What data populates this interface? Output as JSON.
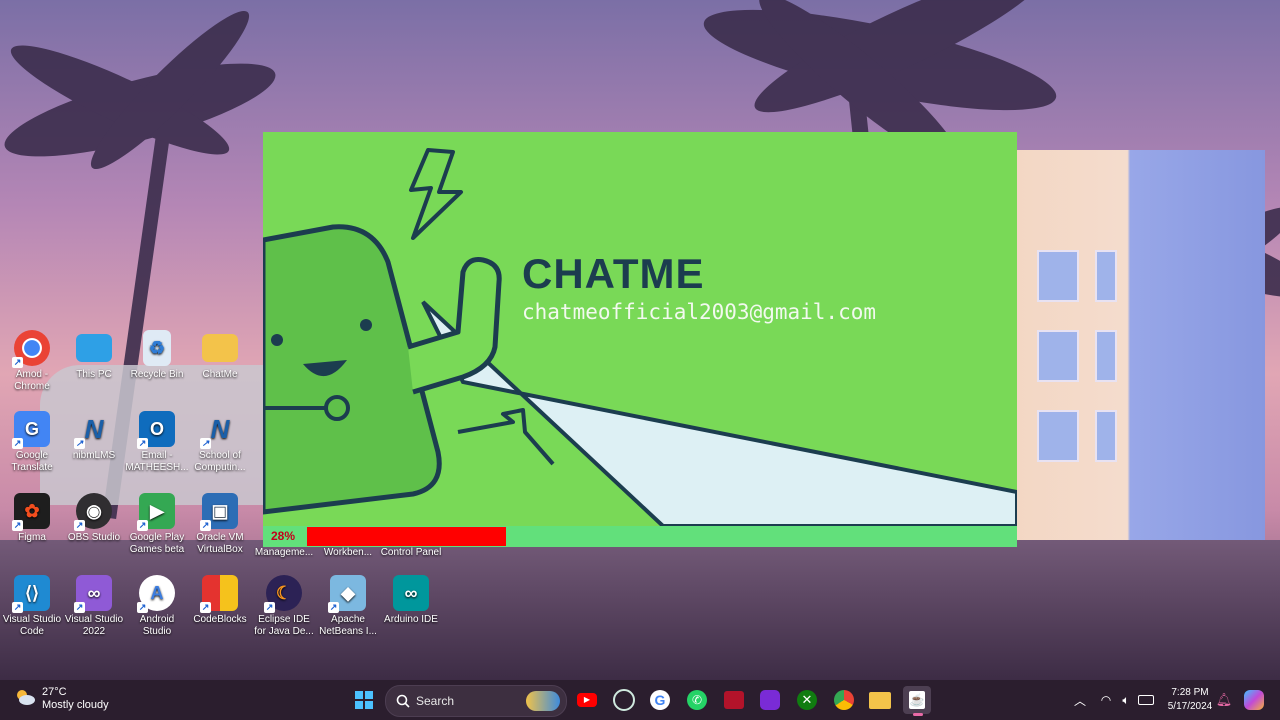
{
  "desktop_icons": [
    {
      "name": "chrome",
      "label": "Amod - Chrome",
      "icon": "chrome-icon",
      "color": "#4285f4"
    },
    {
      "name": "this-pc",
      "label": "This PC",
      "icon": "monitor-icon",
      "color": "#2ea0e6"
    },
    {
      "name": "recycle-bin",
      "label": "Recycle Bin",
      "icon": "recycle-bin-icon",
      "color": "#dfeaf5"
    },
    {
      "name": "chatme",
      "label": "ChatMe",
      "icon": "folder-icon",
      "color": "#f3c34a"
    },
    {
      "name": "google-translate",
      "label": "Google Translate",
      "icon": "translate-icon",
      "color": "#4285f4"
    },
    {
      "name": "nibmlms",
      "label": "nibmLMS",
      "icon": "n-logo-icon",
      "color": "#1a5fa8"
    },
    {
      "name": "email",
      "label": "Email - MATHEESH...",
      "icon": "outlook-icon",
      "color": "#0f6cbd"
    },
    {
      "name": "school-of-computing",
      "label": "School of Computin...",
      "icon": "n-logo-icon",
      "color": "#1a5fa8"
    },
    {
      "name": "figma",
      "label": "Figma",
      "icon": "figma-icon",
      "color": "#1e1e1e"
    },
    {
      "name": "obs-studio",
      "label": "OBS Studio",
      "icon": "obs-icon",
      "color": "#302e31"
    },
    {
      "name": "google-play-games",
      "label": "Google Play Games beta",
      "icon": "play-games-icon",
      "color": "#34a853"
    },
    {
      "name": "oracle-vm",
      "label": "Oracle VM VirtualBox",
      "icon": "virtualbox-icon",
      "color": "#2d6db5"
    },
    {
      "name": "vscode",
      "label": "Visual Studio Code",
      "icon": "vscode-icon",
      "color": "#1f8ad2"
    },
    {
      "name": "visual-studio",
      "label": "Visual Studio 2022",
      "icon": "visual-studio-icon",
      "color": "#8f5ad6"
    },
    {
      "name": "android-studio",
      "label": "Android Studio",
      "icon": "android-studio-icon",
      "color": "#ffffff"
    },
    {
      "name": "codeblocks",
      "label": "CodeBlocks",
      "icon": "codeblocks-icon",
      "color": "#e4332f"
    },
    {
      "name": "eclipse",
      "label": "Eclipse IDE for Java De...",
      "icon": "eclipse-icon",
      "color": "#2c2255"
    },
    {
      "name": "netbeans",
      "label": "Apache NetBeans I...",
      "icon": "netbeans-icon",
      "color": "#7cb8e0"
    },
    {
      "name": "arduino",
      "label": "Arduino IDE",
      "icon": "arduino-icon",
      "color": "#00979c"
    }
  ],
  "partial_icons": {
    "management": "Manageme...",
    "workbench": "Workben...",
    "control_panel": "Control Panel"
  },
  "splash": {
    "title": "CHATME",
    "email": "chatmeofficial2003@gmail.com",
    "progress_text": "28%",
    "progress_value": 0.28,
    "bg_color": "#79d957",
    "bar_color": "#ff0000",
    "track_color": "#62e07b"
  },
  "taskbar": {
    "weather": {
      "temp": "27°C",
      "condition": "Mostly cloudy",
      "icon": "cloud-sun-icon"
    },
    "search_label": "Search",
    "apps": [
      "windows-start-icon",
      "search-icon",
      "youtube-icon",
      "chatgpt-icon",
      "google-icon",
      "whatsapp-icon",
      "app-red-icon",
      "app-purple-icon",
      "xbox-icon",
      "chrome-icon",
      "file-explorer-icon",
      "java-app-icon"
    ],
    "time": "7:28 PM",
    "date": "5/17/2024"
  }
}
